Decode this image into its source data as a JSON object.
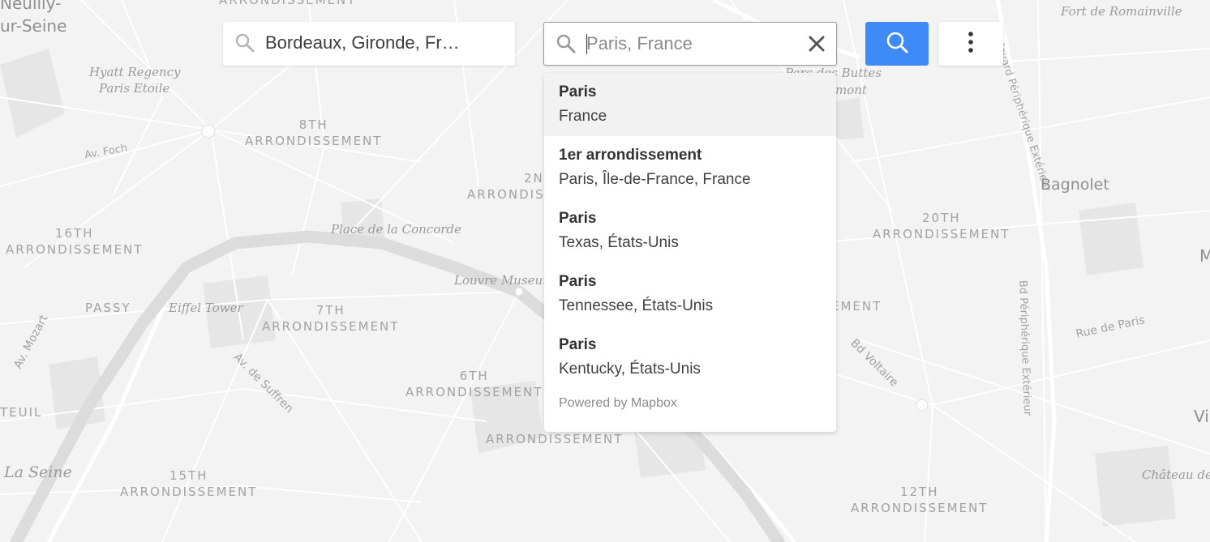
{
  "map": {
    "districts": [
      {
        "num": "8TH",
        "name": "ARRONDISSEMENT"
      },
      {
        "num": "16TH",
        "name": "ARRONDISSEMENT"
      },
      {
        "num": "7TH",
        "name": "ARRONDISSEMENT"
      },
      {
        "num": "6TH",
        "name": "ARRONDISSEMENT"
      },
      {
        "num": "15TH",
        "name": "ARRONDISSEMENT"
      },
      {
        "num": "20TH",
        "name": "ARRONDISSEMENT"
      },
      {
        "num": "12TH",
        "name": "ARRONDISSEMENT"
      },
      {
        "num": "2N",
        "name": "ARRONDIS"
      }
    ],
    "labels": {
      "neuilly_1": "Neuilly-",
      "neuilly_2": "ur-Seine",
      "top_arr": "ARRONDISSEMENT",
      "hyatt_1": "Hyatt Regency",
      "hyatt_2": "Paris Etoile",
      "av_foch": "Av. Foch",
      "place_concorde": "Place de la Concorde",
      "louvre": "Louvre Museum",
      "passy": "PASSY",
      "eiffel": "Eiffel Tower",
      "av_mozart": "Av. Mozart",
      "av_suffren": "Av. de Suffren",
      "auteuil": "TEUIL",
      "la_seine": "La Seine",
      "arr_bottom": "ARRONDISSEMENT",
      "ement": "EMENT",
      "fort": "Fort de Romainville",
      "parc_1": "Parc des Buttes",
      "parc_2": "mont",
      "periph_1": "Boulevard Périphérique Extérieur",
      "bagnolet": "Bagnolet",
      "periph_2": "Bd Périphérique Extérieur",
      "rue_paris": "Rue de Paris",
      "bd_voltaire": "Bd Voltaire",
      "chateau": "Château de",
      "edge_m": "M",
      "edge_vi": "Vi"
    }
  },
  "from_search": {
    "value": "Bordeaux, Gironde, Fr…",
    "icon": "search-icon"
  },
  "to_search": {
    "value": "",
    "placeholder": "Paris, France",
    "icon": "search-icon",
    "clear_icon": "close-icon"
  },
  "go_button": {
    "icon": "search-icon",
    "color": "#3e8af7"
  },
  "menu_button": {
    "icon": "more-vertical-icon"
  },
  "suggestions": [
    {
      "title": "Paris",
      "subtitle": "France",
      "active": true
    },
    {
      "title": "1er arrondissement",
      "subtitle": "Paris, Île-de-France, France"
    },
    {
      "title": "Paris",
      "subtitle": "Texas, États-Unis"
    },
    {
      "title": "Paris",
      "subtitle": "Tennessee, États-Unis"
    },
    {
      "title": "Paris",
      "subtitle": "Kentucky, États-Unis"
    }
  ],
  "powered_by": "Powered by Mapbox"
}
